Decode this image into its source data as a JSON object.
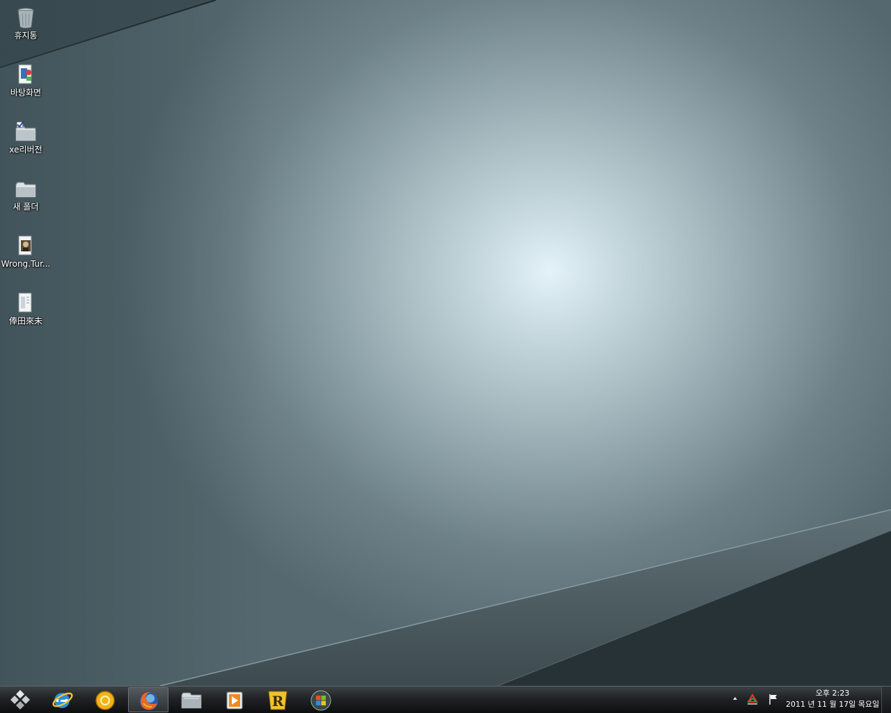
{
  "desktop": {
    "icons": [
      {
        "label": "휴지통",
        "icon": "recycle-bin-icon"
      },
      {
        "label": "바탕화면",
        "icon": "desktop-shortcut-icon"
      },
      {
        "label": "xe리버전",
        "icon": "folder-check-icon"
      },
      {
        "label": "새 폴더",
        "icon": "folder-icon"
      },
      {
        "label": "Wrong.Tur...",
        "icon": "video-file-icon"
      },
      {
        "label": "俸田來未",
        "icon": "file-icon"
      }
    ]
  },
  "taskbar": {
    "start_icon": "start-orb-icon",
    "pinned": [
      {
        "icon": "internet-explorer-icon",
        "active": false
      },
      {
        "icon": "gold-ring-app-icon",
        "active": false
      },
      {
        "icon": "firefox-icon",
        "active": true
      },
      {
        "icon": "explorer-folder-icon",
        "active": false
      },
      {
        "icon": "media-player-icon",
        "active": false
      },
      {
        "icon": "r-app-icon",
        "active": false
      },
      {
        "icon": "windows-logo-icon",
        "active": false
      }
    ],
    "tray": {
      "icons": [
        "show-hidden-arrow-icon",
        "network-icon",
        "action-center-flag-icon"
      ],
      "time": "오후 2:23",
      "date": "2011 년 11 월 17일 목요일"
    }
  }
}
